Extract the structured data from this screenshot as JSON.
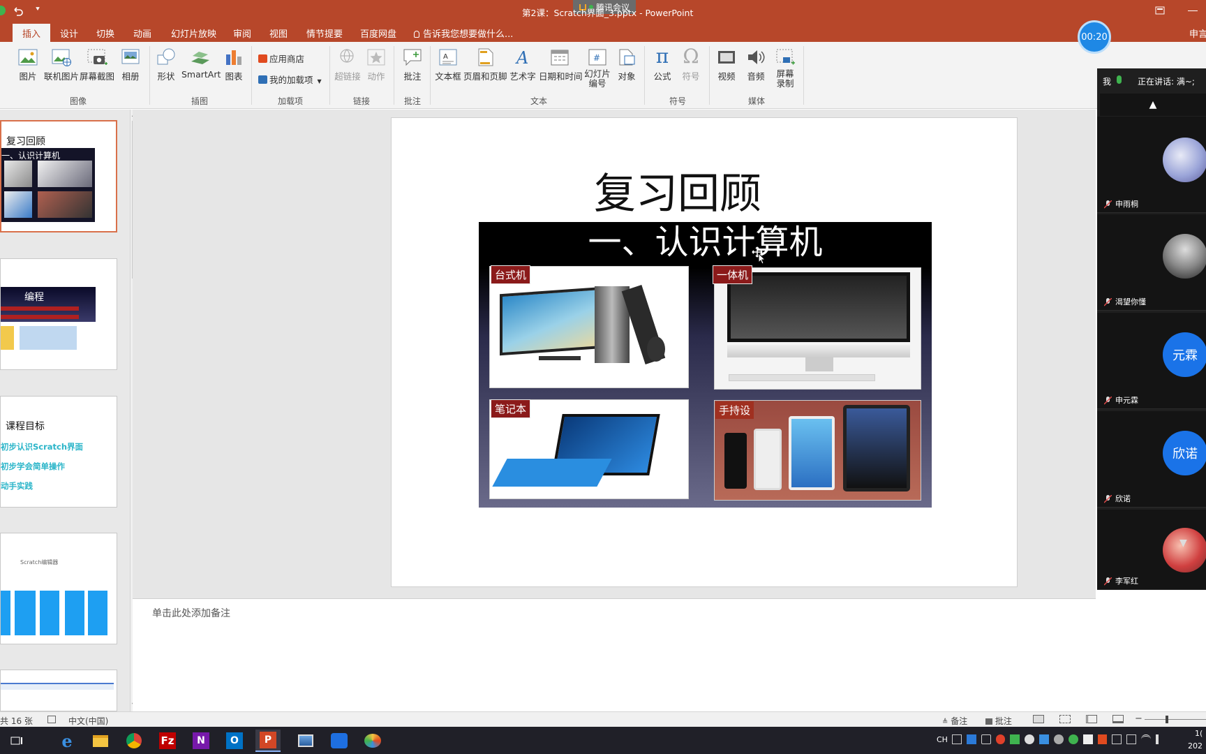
{
  "window": {
    "title": "第2课：Scratch界面_3.pptx - PowerPoint",
    "overlay_app": "腾讯会议",
    "timer": "00:20"
  },
  "tabs": [
    {
      "label": "插入",
      "active": true
    },
    {
      "label": "设计"
    },
    {
      "label": "切换"
    },
    {
      "label": "动画"
    },
    {
      "label": "幻灯片放映"
    },
    {
      "label": "审阅"
    },
    {
      "label": "视图"
    },
    {
      "label": "情节提要"
    },
    {
      "label": "百度网盘"
    }
  ],
  "tell_me": "告诉我您想要做什么...",
  "user_name": "申言",
  "ribbon": {
    "image_group": {
      "label": "图像",
      "buttons": [
        "图片",
        "联机图片",
        "屏幕截图",
        "相册"
      ]
    },
    "illustration_group": {
      "label": "插图",
      "buttons": [
        "形状",
        "SmartArt",
        "图表"
      ]
    },
    "addins_group": {
      "label": "加载项",
      "buttons": [
        "应用商店",
        "我的加载项"
      ]
    },
    "links_group": {
      "label": "链接",
      "buttons": [
        "超链接",
        "动作"
      ]
    },
    "comment_group": {
      "label": "批注",
      "buttons": [
        "批注"
      ]
    },
    "text_group": {
      "label": "文本",
      "buttons": [
        "文本框",
        "页眉和页脚",
        "艺术字",
        "日期和时间",
        "幻灯片",
        "编号",
        "对象"
      ]
    },
    "symbol_group": {
      "label": "符号",
      "buttons": [
        "公式",
        "符号"
      ]
    },
    "media_group": {
      "label": "媒体",
      "buttons": [
        "视频",
        "音频",
        "屏幕",
        "录制"
      ]
    }
  },
  "thumbnails": {
    "t1_title": "复习回顾",
    "t1_sub": "一、认识计算机",
    "t2_title": "编程",
    "t3_title": "课程目标",
    "t3_items": [
      "初步认识Scratch界面",
      "初步学会简单操作",
      "动手实践"
    ],
    "t4_title": "Scratch编辑器"
  },
  "slide": {
    "title": "复习回顾",
    "image_title": "一、认识计算机",
    "labels": [
      "台式机",
      "一体机",
      "笔记本",
      "手持设"
    ]
  },
  "notes_placeholder": "单击此处添加备注",
  "status": {
    "slide_count": "共 16 张",
    "language": "中文(中国)",
    "notes": "备注",
    "comments": "批注"
  },
  "meeting": {
    "me": "我",
    "speaking_label": "正在讲话: 满~;",
    "participants": [
      {
        "name": "申雨桐",
        "avatar": "photo"
      },
      {
        "name": "渴望你懂",
        "avatar": "photo"
      },
      {
        "name": "申元霖",
        "avatar": "元霖"
      },
      {
        "name": "欣诺",
        "avatar": "欣诺"
      },
      {
        "name": "李军红",
        "avatar": "photo"
      }
    ]
  },
  "taskbar": {
    "input_lang": "CH",
    "clock_line1": "1(",
    "clock_line2": "202"
  },
  "colors": {
    "accent": "#b7472a",
    "meeting_bg": "#1f1f1f",
    "avatar_blue": "#1a73e8"
  }
}
